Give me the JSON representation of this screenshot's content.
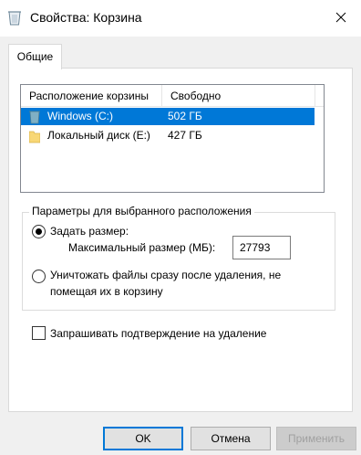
{
  "window": {
    "title": "Свойства: Корзина",
    "icon": "recycle-bin-icon",
    "close_icon": "close-icon"
  },
  "tabs": [
    {
      "label": "Общие",
      "active": true
    }
  ],
  "locations": {
    "columns": [
      "Расположение корзины",
      "Свободно"
    ],
    "rows": [
      {
        "name": "Windows (C:)",
        "free": "502 ГБ",
        "icon": "trash-folder-icon",
        "selected": true
      },
      {
        "name": "Локальный диск (E:)",
        "free": "427 ГБ",
        "icon": "folder-icon",
        "selected": false
      }
    ]
  },
  "settings": {
    "legend": "Параметры для выбранного расположения",
    "custom_size_label": "Задать размер:",
    "custom_size_selected": true,
    "max_size_label": "Максимальный размер (МБ):",
    "max_size_value": "27793",
    "delete_immediately_label_line1": "Уничтожать файлы сразу после удаления, не",
    "delete_immediately_label_line2": "помещая их в корзину",
    "delete_immediately_selected": false
  },
  "confirm_delete": {
    "label": "Запрашивать подтверждение на удаление",
    "checked": false
  },
  "buttons": {
    "ok": "OK",
    "cancel": "Отмена",
    "apply": "Применить",
    "apply_enabled": false
  },
  "colors": {
    "selection": "#0078d7",
    "folder_yellow": "#f8d775",
    "folder_teal": "#6a9fb5"
  }
}
